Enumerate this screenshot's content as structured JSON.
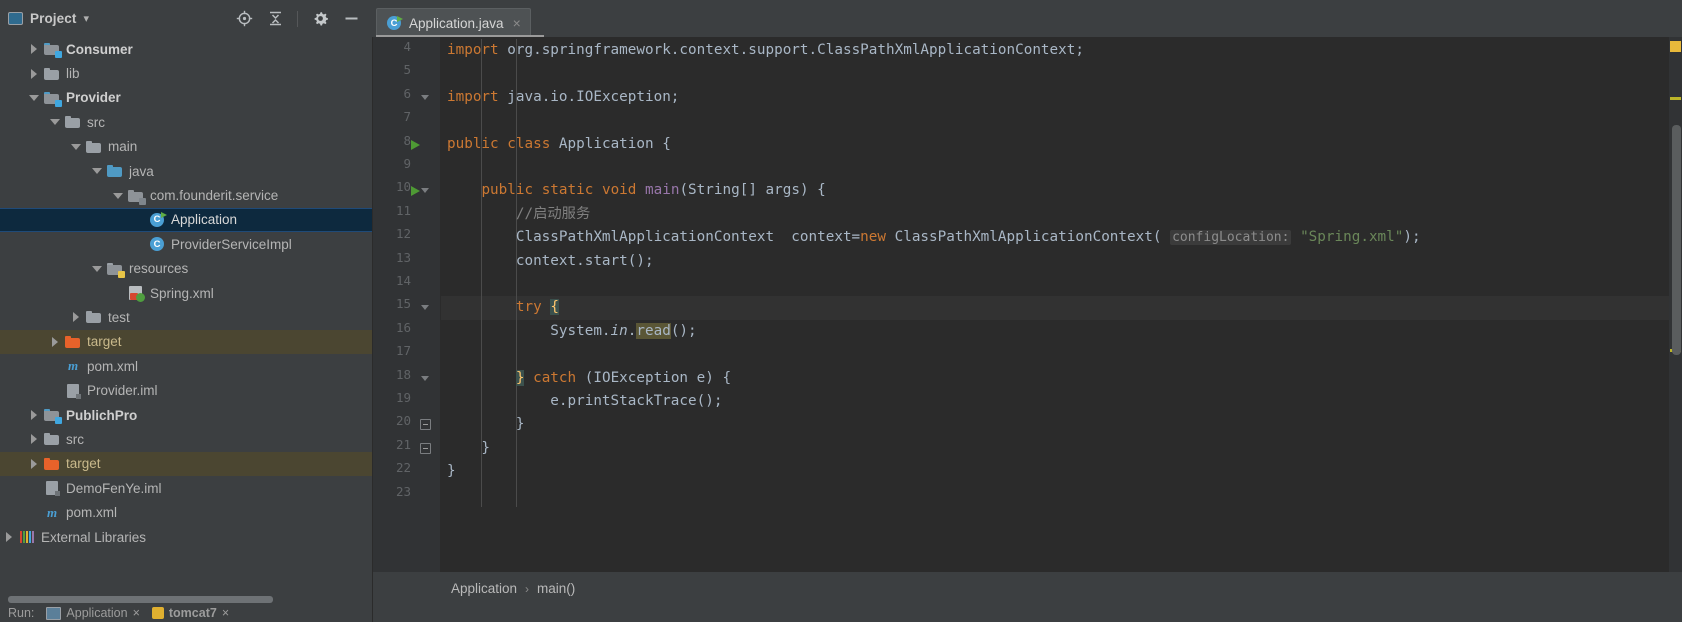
{
  "toolwindow": {
    "title": "Project",
    "dropdown_glyph": "▾",
    "icons": [
      {
        "name": "locate-icon",
        "glyph": "⊕"
      },
      {
        "name": "collapse-all-icon",
        "glyph": "⇅"
      },
      {
        "name": "settings-gear-icon",
        "glyph": "⚙"
      },
      {
        "name": "hide-icon",
        "glyph": "—"
      }
    ]
  },
  "tree": [
    {
      "label": "Consumer",
      "indent": 0,
      "arrow": "closed",
      "icon": "module-folder",
      "bold": true,
      "state": "normal"
    },
    {
      "label": "lib",
      "indent": 0,
      "arrow": "closed",
      "icon": "folder-gray",
      "bold": false,
      "state": "normal"
    },
    {
      "label": "Provider",
      "indent": 0,
      "arrow": "open",
      "icon": "module-folder",
      "bold": true,
      "state": "normal"
    },
    {
      "label": "src",
      "indent": 1,
      "arrow": "open",
      "icon": "folder-gray",
      "bold": false,
      "state": "normal"
    },
    {
      "label": "main",
      "indent": 2,
      "arrow": "open",
      "icon": "folder-gray",
      "bold": false,
      "state": "normal"
    },
    {
      "label": "java",
      "indent": 3,
      "arrow": "open",
      "icon": "folder-blue",
      "bold": false,
      "state": "normal"
    },
    {
      "label": "com.founderit.service",
      "indent": 4,
      "arrow": "open",
      "icon": "package",
      "bold": false,
      "state": "normal"
    },
    {
      "label": "Application",
      "indent": 5,
      "arrow": "none",
      "icon": "class-runnable",
      "bold": false,
      "state": "selected"
    },
    {
      "label": "ProviderServiceImpl",
      "indent": 5,
      "arrow": "none",
      "icon": "class",
      "bold": false,
      "state": "normal"
    },
    {
      "label": "resources",
      "indent": 3,
      "arrow": "open",
      "icon": "folder-resources",
      "bold": false,
      "state": "normal"
    },
    {
      "label": "Spring.xml",
      "indent": 4,
      "arrow": "none",
      "icon": "spring-xml",
      "bold": false,
      "state": "normal"
    },
    {
      "label": "test",
      "indent": 2,
      "arrow": "closed",
      "icon": "folder-gray",
      "bold": false,
      "state": "normal"
    },
    {
      "label": "target",
      "indent": 1,
      "arrow": "closed",
      "icon": "folder-orange",
      "bold": false,
      "state": "excluded"
    },
    {
      "label": "pom.xml",
      "indent": 1,
      "arrow": "none",
      "icon": "maven",
      "bold": false,
      "state": "normal"
    },
    {
      "label": "Provider.iml",
      "indent": 1,
      "arrow": "none",
      "icon": "iml",
      "bold": false,
      "state": "normal"
    },
    {
      "label": "PublichPro",
      "indent": 0,
      "arrow": "closed",
      "icon": "module-folder",
      "bold": true,
      "state": "normal"
    },
    {
      "label": "src",
      "indent": 0,
      "arrow": "closed",
      "icon": "folder-gray",
      "bold": false,
      "state": "normal"
    },
    {
      "label": "target",
      "indent": 0,
      "arrow": "closed",
      "icon": "folder-orange",
      "bold": false,
      "state": "excluded"
    },
    {
      "label": "DemoFenYe.iml",
      "indent": 0,
      "arrow": "none",
      "icon": "iml",
      "bold": false,
      "state": "normal"
    },
    {
      "label": "pom.xml",
      "indent": 0,
      "arrow": "none",
      "icon": "maven",
      "bold": false,
      "state": "normal"
    },
    {
      "label": "External Libraries",
      "indent": -1,
      "arrow": "closed",
      "icon": "libraries",
      "bold": false,
      "state": "normal"
    }
  ],
  "run_strip": {
    "label": "Run:",
    "tabs": [
      {
        "name": "Application",
        "close": "×"
      },
      {
        "name": "tomcat7",
        "close": "×"
      }
    ]
  },
  "editor": {
    "tab": {
      "filename": "Application.java",
      "close_glyph": "×",
      "icon": "java-class-runnable-icon"
    },
    "first_line_number": 4,
    "lines": [
      {
        "num": 4,
        "tokens": [
          {
            "t": "import ",
            "c": "kw"
          },
          {
            "t": "org.springframework.context.support.ClassPathXmlApplicationContext;",
            "c": "pln"
          }
        ],
        "indent": 0
      },
      {
        "num": 5,
        "tokens": [],
        "indent": 0
      },
      {
        "num": 6,
        "tokens": [
          {
            "t": "import ",
            "c": "kw"
          },
          {
            "t": "java.io.IOException;",
            "c": "pln"
          }
        ],
        "indent": 0
      },
      {
        "num": 7,
        "tokens": [],
        "indent": 0
      },
      {
        "num": 8,
        "tokens": [
          {
            "t": "public ",
            "c": "kw"
          },
          {
            "t": "class ",
            "c": "kw"
          },
          {
            "t": "Application ",
            "c": "pln"
          },
          {
            "t": "{",
            "c": "pln"
          }
        ],
        "indent": 0
      },
      {
        "num": 9,
        "tokens": [],
        "indent": 0
      },
      {
        "num": 10,
        "tokens": [
          {
            "t": "    ",
            "c": "pln"
          },
          {
            "t": "public ",
            "c": "kw"
          },
          {
            "t": "static ",
            "c": "kw"
          },
          {
            "t": "void ",
            "c": "kw"
          },
          {
            "t": "main",
            "c": "fld"
          },
          {
            "t": "(String[] args) {",
            "c": "pln"
          }
        ],
        "indent": 1
      },
      {
        "num": 11,
        "tokens": [
          {
            "t": "        //启动服务",
            "c": "cmt"
          }
        ],
        "indent": 2
      },
      {
        "num": 12,
        "tokens": [
          {
            "t": "        ClassPathXmlApplicationContext  context=",
            "c": "pln"
          },
          {
            "t": "new ",
            "c": "kw"
          },
          {
            "t": "ClassPathXmlApplicationContext( ",
            "c": "pln"
          },
          {
            "t": "configLocation:",
            "c": "hint"
          },
          {
            "t": " ",
            "c": "pln"
          },
          {
            "t": "\"Spring.xml\"",
            "c": "str"
          },
          {
            "t": ");",
            "c": "pln"
          }
        ],
        "indent": 2
      },
      {
        "num": 13,
        "tokens": [
          {
            "t": "        context.start();",
            "c": "pln"
          }
        ],
        "indent": 2
      },
      {
        "num": 14,
        "tokens": [],
        "indent": 2
      },
      {
        "num": 15,
        "tokens": [
          {
            "t": "        ",
            "c": "pln"
          },
          {
            "t": "try ",
            "c": "kw"
          },
          {
            "t": "{",
            "c": "brace-hl"
          }
        ],
        "indent": 2
      },
      {
        "num": 16,
        "tokens": [
          {
            "t": "            System.",
            "c": "pln"
          },
          {
            "t": "in",
            "c": "stc"
          },
          {
            "t": ".",
            "c": "pln"
          },
          {
            "t": "read",
            "c": "ident-hl"
          },
          {
            "t": "();",
            "c": "pln"
          }
        ],
        "indent": 3
      },
      {
        "num": 17,
        "tokens": [],
        "indent": 3
      },
      {
        "num": 18,
        "tokens": [
          {
            "t": "        ",
            "c": "pln"
          },
          {
            "t": "}",
            "c": "brace-hl"
          },
          {
            "t": " ",
            "c": "pln"
          },
          {
            "t": "catch ",
            "c": "kw"
          },
          {
            "t": "(IOException e) {",
            "c": "pln"
          }
        ],
        "indent": 2
      },
      {
        "num": 19,
        "tokens": [
          {
            "t": "            e.printStackTrace();",
            "c": "pln"
          }
        ],
        "indent": 3
      },
      {
        "num": 20,
        "tokens": [
          {
            "t": "        }",
            "c": "pln"
          }
        ],
        "indent": 2
      },
      {
        "num": 21,
        "tokens": [
          {
            "t": "    }",
            "c": "pln"
          }
        ],
        "indent": 1
      },
      {
        "num": 22,
        "tokens": [
          {
            "t": "}",
            "c": "pln"
          }
        ],
        "indent": 0
      },
      {
        "num": 23,
        "tokens": [],
        "indent": 0
      }
    ],
    "run_arrow_lines": [
      8,
      10
    ],
    "fold_lines": [
      6,
      10,
      15,
      18,
      20,
      21
    ],
    "highlighted_line": 15,
    "breadcrumb": [
      {
        "label": "Application"
      },
      {
        "label": "main()"
      }
    ],
    "breadcrumb_separator": "›"
  },
  "colors": {
    "background": "#2b2b2b",
    "chrome": "#3c3f41",
    "gutter": "#313335",
    "selection": "#0d293e",
    "excluded": "#4b4631",
    "keyword": "#cc7832",
    "string": "#6a8759",
    "comment": "#808080",
    "plain": "#a9b7c6",
    "warning_marker": "#bbb529",
    "error_box": "#e8b93b"
  }
}
